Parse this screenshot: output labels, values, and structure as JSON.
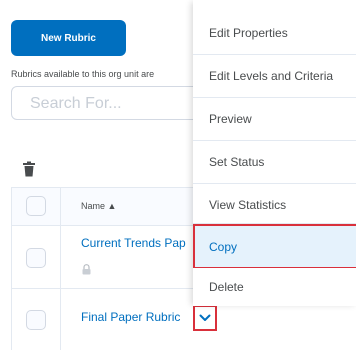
{
  "toolbar": {
    "new_rubric_label": "New Rubric",
    "available_text": "Rubrics available to this org unit are",
    "search_placeholder": "Search For...",
    "delete_icon": "trash-icon"
  },
  "table": {
    "columns": [
      "Name ▲"
    ],
    "rows": [
      {
        "name": "Current Trends Pap",
        "locked": true
      },
      {
        "name": "Final Paper Rubric",
        "locked": false
      }
    ]
  },
  "menu": {
    "items": [
      "Edit Properties",
      "Edit Levels and Criteria",
      "Preview",
      "Set Status",
      "View Statistics",
      "Copy",
      "Delete"
    ],
    "highlighted": "Copy"
  },
  "colors": {
    "primary": "#006fbf",
    "highlight_border": "#d9303b",
    "hover_bg": "#e5f2fc"
  }
}
